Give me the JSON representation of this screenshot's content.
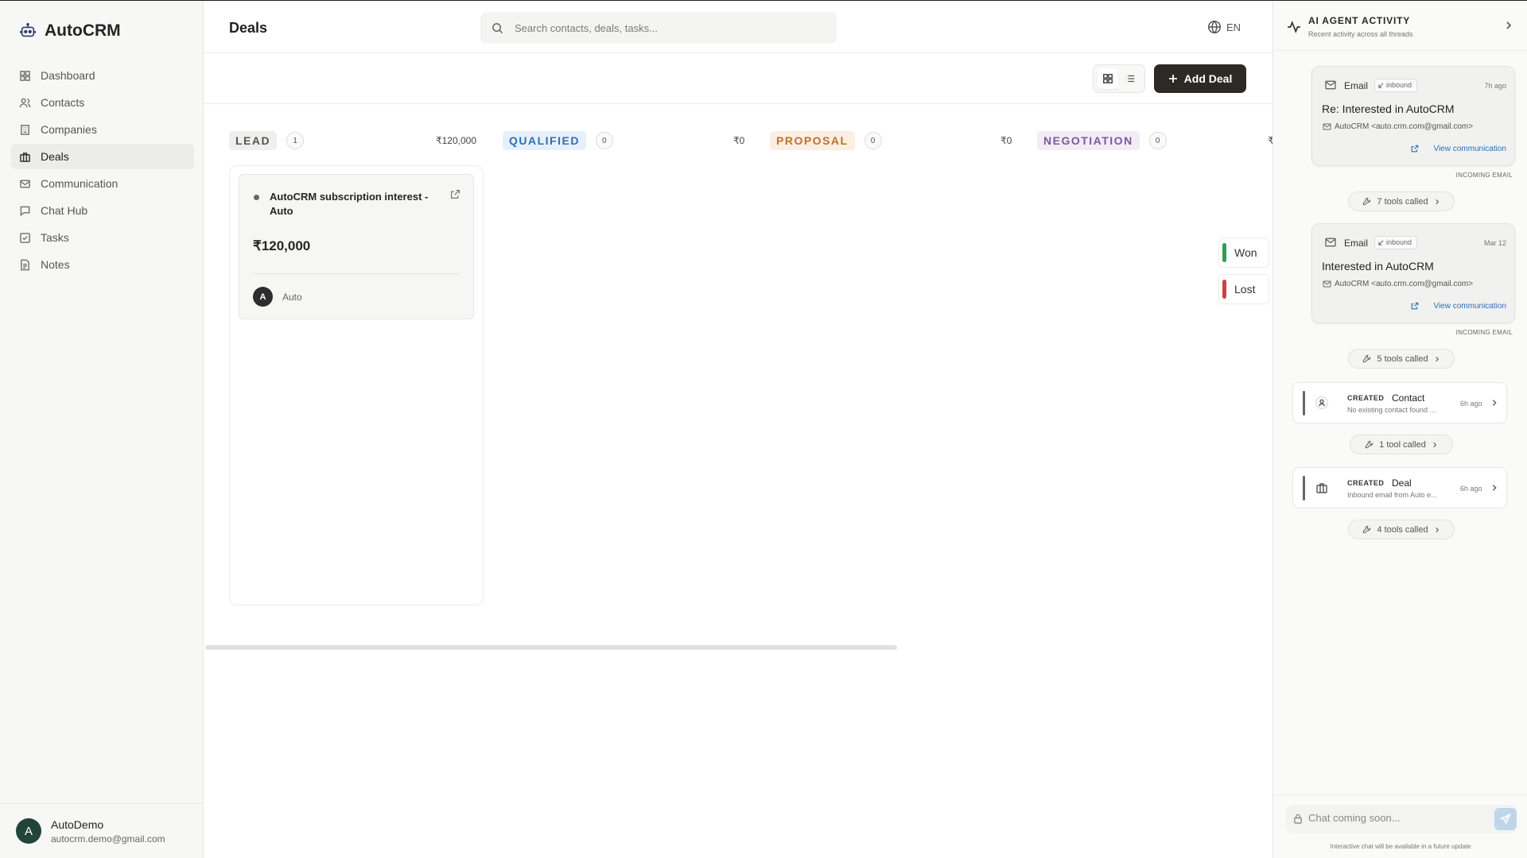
{
  "app": {
    "name": "AutoCRM"
  },
  "sidebar": {
    "items": [
      {
        "label": "Dashboard",
        "icon": "dashboard-icon"
      },
      {
        "label": "Contacts",
        "icon": "users-icon"
      },
      {
        "label": "Companies",
        "icon": "building-icon"
      },
      {
        "label": "Deals",
        "icon": "briefcase-icon",
        "active": true
      },
      {
        "label": "Communication",
        "icon": "mail-icon"
      },
      {
        "label": "Chat Hub",
        "icon": "message-icon"
      },
      {
        "label": "Tasks",
        "icon": "checkbox-icon"
      },
      {
        "label": "Notes",
        "icon": "note-icon"
      }
    ],
    "user": {
      "initial": "A",
      "name": "AutoDemo",
      "email": "autocrm.demo@gmail.com"
    }
  },
  "header": {
    "title": "Deals",
    "search_placeholder": "Search contacts, deals, tasks...",
    "language": "EN"
  },
  "toolbar": {
    "add_deal_label": "Add Deal"
  },
  "board": {
    "columns": [
      {
        "stage": "LEAD",
        "count": "1",
        "total": "₹120,000",
        "color": "#555555",
        "bg": "#efefed"
      },
      {
        "stage": "QUALIFIED",
        "count": "0",
        "total": "₹0",
        "color": "#2f6fb5",
        "bg": "#e7f0fa"
      },
      {
        "stage": "PROPOSAL",
        "count": "0",
        "total": "₹0",
        "color": "#c0702a",
        "bg": "#fbeee2"
      },
      {
        "stage": "NEGOTIATION",
        "count": "0",
        "total": "₹",
        "color": "#7a5a9c",
        "bg": "#f1ecf6"
      }
    ],
    "deal": {
      "title": "AutoCRM subscription interest - Auto",
      "amount": "₹120,000",
      "owner_initial": "A",
      "owner": "Auto"
    },
    "drop_zones": [
      {
        "label": "Won",
        "color": "#2e9d57"
      },
      {
        "label": "Lost",
        "color": "#c94343"
      }
    ]
  },
  "panel": {
    "title": "AI AGENT ACTIVITY",
    "subtitle": "Recent activity across all threads",
    "emails": [
      {
        "type": "Email",
        "direction": "inbound",
        "time": "7h ago",
        "subject": "Re: Interested in AutoCRM",
        "from": "AutoCRM <auto.crm.com@gmail.com>",
        "view": "View communication",
        "tag": "INCOMING EMAIL",
        "tools": "7 tools called"
      },
      {
        "type": "Email",
        "direction": "inbound",
        "time": "Mar 12",
        "subject": "Interested in AutoCRM",
        "from": "AutoCRM <auto.crm.com@gmail.com>",
        "view": "View communication",
        "tag": "INCOMING EMAIL",
        "tools": "5 tools called"
      }
    ],
    "created": [
      {
        "label": "CREATED",
        "entity": "Contact",
        "desc": "No existing contact found ...",
        "time": "6h ago",
        "icon": "user-icon",
        "tools": "1 tool called"
      },
      {
        "label": "CREATED",
        "entity": "Deal",
        "desc": "Inbound email from Auto e...",
        "time": "6h ago",
        "icon": "briefcase-icon",
        "tools": "4 tools called"
      }
    ],
    "chat_placeholder": "Chat coming soon...",
    "chat_note": "Interactive chat will be available in a future update"
  }
}
